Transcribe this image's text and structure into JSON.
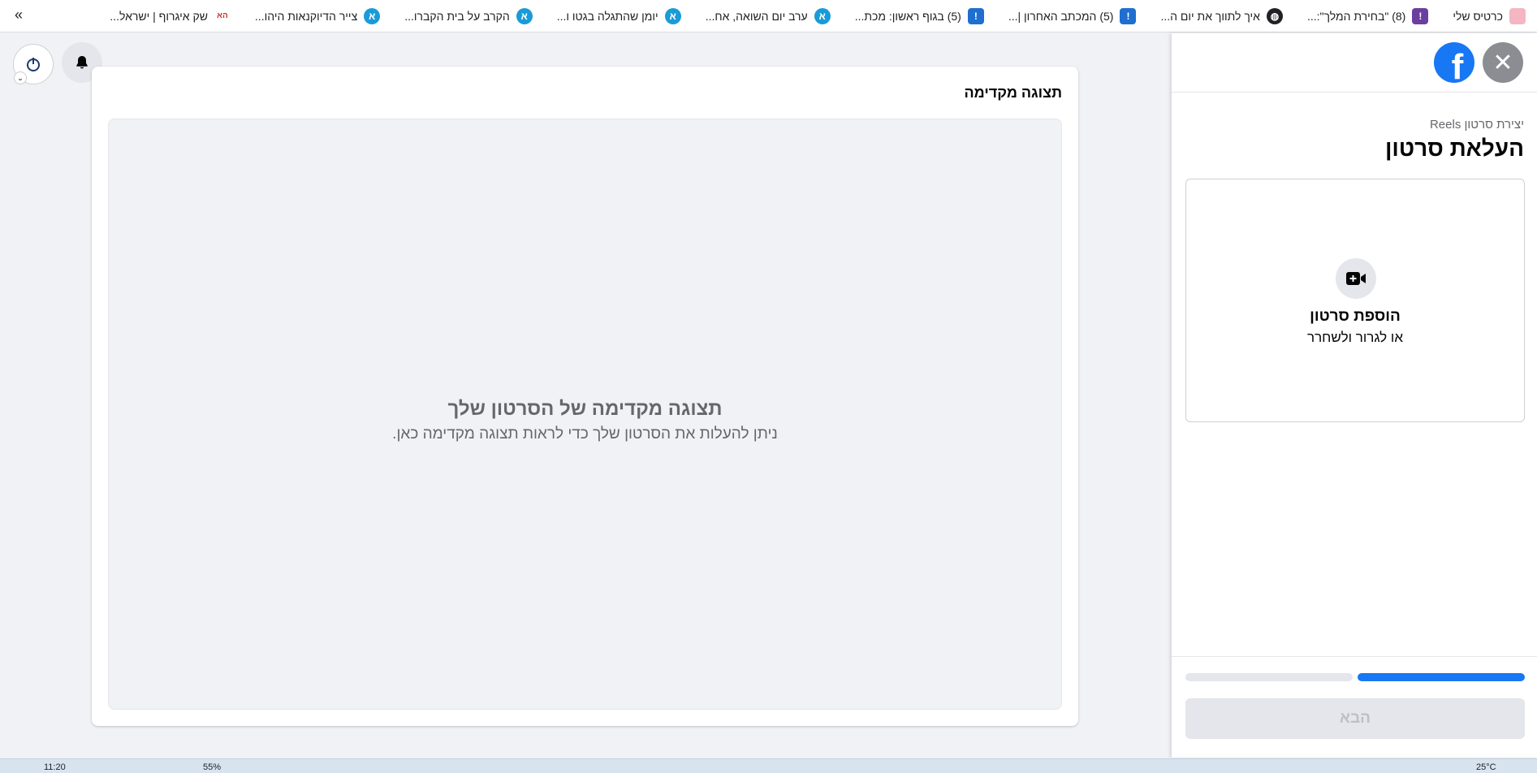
{
  "bookmarks": {
    "items": [
      {
        "label": "כרטיס שלי",
        "icon": "card-icon",
        "color": "#ffffff"
      },
      {
        "label": "(8) \"בחירת המלך\":...",
        "icon": "exclaim-icon",
        "color": "#6a3fa0"
      },
      {
        "label": "איך לתווך את יום ה...",
        "icon": "globe-icon",
        "color": "#202124"
      },
      {
        "label": "(5) המכתב האחרון |...",
        "icon": "exclaim-icon",
        "color": "#1e6fd0"
      },
      {
        "label": "(5) בגוף ראשון: מכת...",
        "icon": "exclaim-icon",
        "color": "#1e6fd0"
      },
      {
        "label": "ערב יום השואה, אח...",
        "icon": "aleph-icon",
        "color": "#1a9bd7"
      },
      {
        "label": "יומן שהתגלה בגטו ו...",
        "icon": "aleph-icon",
        "color": "#1a9bd7"
      },
      {
        "label": "הקרב על בית הקברו...",
        "icon": "aleph-icon",
        "color": "#1a9bd7"
      },
      {
        "label": "צייר הדיוקנאות היהו...",
        "icon": "aleph-icon",
        "color": "#1a9bd7"
      },
      {
        "label": "שק איגרוף | ישראל...",
        "icon": "haaretz-icon",
        "color": "#d32f2f"
      }
    ],
    "more": "»"
  },
  "panel": {
    "close": "✕",
    "logo": "f",
    "breadcrumb": "יצירת סרטון Reels",
    "title": "העלאת סרטון",
    "upload": {
      "title": "הוספת סרטון",
      "subtitle": "או לגרור ולשחרר"
    },
    "progress": {
      "steps_total": 2,
      "steps_done": 1,
      "active_color": "#1877f2",
      "inactive_color": "#e4e6eb"
    },
    "next_label": "הבא"
  },
  "preview": {
    "card_title": "תצוגה מקדימה",
    "heading": "תצוגה מקדימה של הסרטון שלך",
    "subtext": "ניתן להעלות את הסרטון שלך כדי לראות תצוגה מקדימה כאן."
  },
  "taskbar": {
    "time": "11:20",
    "temp": "25°C",
    "battery": "55%"
  },
  "colors": {
    "brand": "#1877f2",
    "page_bg": "#f0f2f5"
  }
}
